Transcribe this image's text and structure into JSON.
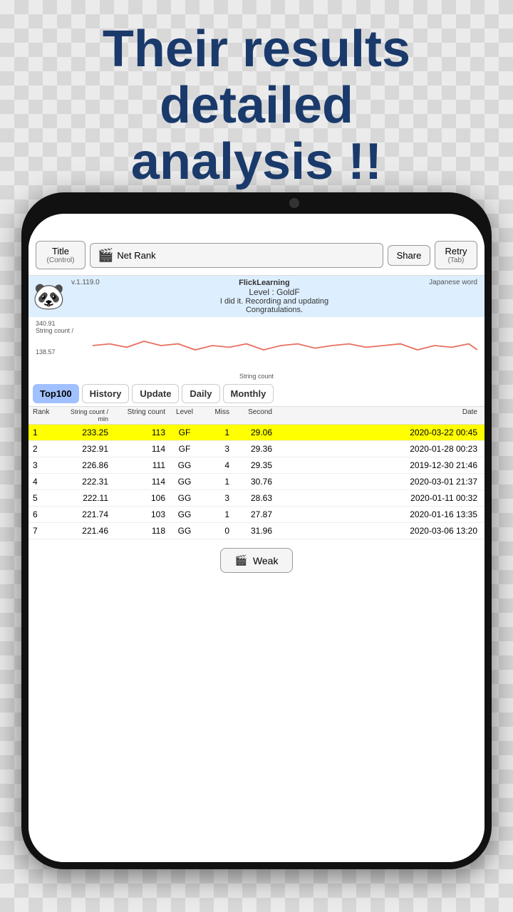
{
  "headline": {
    "line1": "Their results",
    "line2": "detailed",
    "line3": "analysis !!"
  },
  "nav": {
    "title_label": "Title",
    "title_sub": "(Control)",
    "netrank_label": "Net Rank",
    "share_label": "Share",
    "retry_label": "Retry",
    "retry_sub": "(Tab)"
  },
  "info": {
    "version": "v.1.119.0",
    "brand": "FlickLearning",
    "level": "Level : GoldF",
    "message": "I did it. Recording and updating",
    "congrats": "Congratulations.",
    "japanese_word": "Japanese word"
  },
  "chart": {
    "y_max": "340.91",
    "label": "String count /",
    "y_min": "138.57",
    "x_label": "String count"
  },
  "tabs": {
    "items": [
      {
        "id": "top100",
        "label": "Top100",
        "active": true
      },
      {
        "id": "history",
        "label": "History",
        "active": false
      },
      {
        "id": "update",
        "label": "Update",
        "active": false
      },
      {
        "id": "daily",
        "label": "Daily",
        "active": false
      },
      {
        "id": "monthly",
        "label": "Monthly",
        "active": false
      }
    ]
  },
  "table": {
    "columns": [
      "Rank",
      "String count / min",
      "String count",
      "Level",
      "Miss",
      "Second",
      "Date"
    ],
    "rows": [
      {
        "rank": "1",
        "sc_min": "233.25",
        "sc": "113",
        "level": "GF",
        "miss": "1",
        "second": "29.06",
        "date": "2020-03-22 00:45",
        "highlight": true
      },
      {
        "rank": "2",
        "sc_min": "232.91",
        "sc": "114",
        "level": "GF",
        "miss": "3",
        "second": "29.36",
        "date": "2020-01-28 00:23",
        "highlight": false
      },
      {
        "rank": "3",
        "sc_min": "226.86",
        "sc": "111",
        "level": "GG",
        "miss": "4",
        "second": "29.35",
        "date": "2019-12-30 21:46",
        "highlight": false
      },
      {
        "rank": "4",
        "sc_min": "222.31",
        "sc": "114",
        "level": "GG",
        "miss": "1",
        "second": "30.76",
        "date": "2020-03-01 21:37",
        "highlight": false
      },
      {
        "rank": "5",
        "sc_min": "222.11",
        "sc": "106",
        "level": "GG",
        "miss": "3",
        "second": "28.63",
        "date": "2020-01-11 00:32",
        "highlight": false
      },
      {
        "rank": "6",
        "sc_min": "221.74",
        "sc": "103",
        "level": "GG",
        "miss": "1",
        "second": "27.87",
        "date": "2020-01-16 13:35",
        "highlight": false
      },
      {
        "rank": "7",
        "sc_min": "221.46",
        "sc": "118",
        "level": "GG",
        "miss": "0",
        "second": "31.96",
        "date": "2020-03-06 13:20",
        "highlight": false
      }
    ]
  },
  "weak_btn": {
    "label": "Weak"
  }
}
